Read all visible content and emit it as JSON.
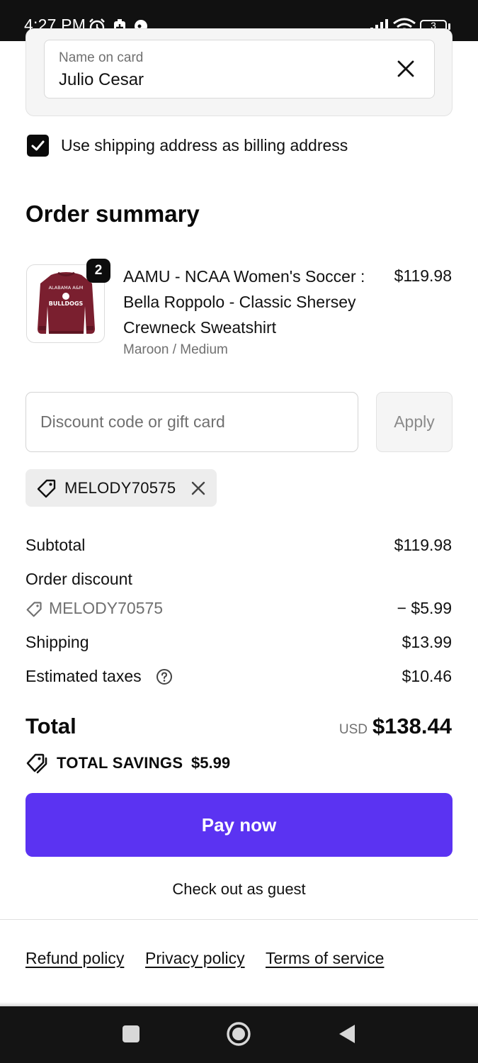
{
  "status_bar": {
    "time": "4:27 PM",
    "battery": "3"
  },
  "payment": {
    "name_label": "Name on card",
    "name_value": "Julio Cesar"
  },
  "billing": {
    "checkbox_label": "Use shipping address as billing address",
    "checked": true
  },
  "order_summary": {
    "title": "Order summary",
    "item": {
      "quantity": "2",
      "name": "AAMU - NCAA Women's Soccer : Bella Roppolo - Classic Shersey Crewneck Sweatshirt",
      "variant": "Maroon / Medium",
      "price": "$119.98",
      "thumb_text_top": "ALABAMA A&M",
      "thumb_text_main": "BULLDOGS"
    }
  },
  "discount": {
    "placeholder": "Discount code or gift card",
    "apply_label": "Apply",
    "applied_code": "MELODY70575"
  },
  "totals": {
    "subtotal_label": "Subtotal",
    "subtotal_value": "$119.98",
    "order_discount_label": "Order discount",
    "discount_code": "MELODY70575",
    "discount_value": "− $5.99",
    "shipping_label": "Shipping",
    "shipping_value": "$13.99",
    "taxes_label": "Estimated taxes",
    "taxes_value": "$10.46",
    "total_label": "Total",
    "currency": "USD",
    "total_value": "$138.44",
    "savings_label": "TOTAL SAVINGS",
    "savings_value": "$5.99"
  },
  "actions": {
    "pay_label": "Pay now",
    "guest_label": "Check out as guest"
  },
  "footer": {
    "links": [
      "Refund policy",
      "Privacy policy",
      "Terms of service"
    ]
  },
  "colors": {
    "accent": "#5b33f2",
    "maroon": "#7a1f2f",
    "status_bar": "#111111"
  }
}
